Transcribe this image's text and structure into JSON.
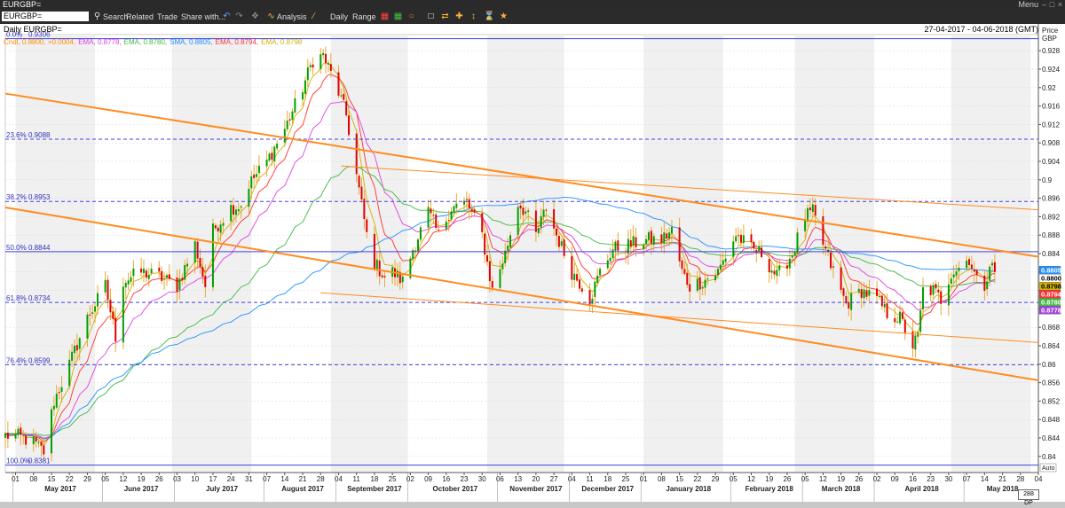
{
  "window": {
    "title": "EURGBP=",
    "menu": "Menu"
  },
  "toolbar": {
    "symbol": "EURGBP=",
    "search": "Search",
    "related": "Related",
    "trade": "Trade",
    "share": "Share with...",
    "analysis": "Analysis",
    "daily": "Daily",
    "range": "Range"
  },
  "header": {
    "label": "Daily EURGBP=",
    "date_range": "27-04-2017 - 04-06-2018 (GMT)",
    "price_label": "Price",
    "currency": "GBP"
  },
  "legend": [
    {
      "text": "Cndl, 0.8800, +0.0004,",
      "color": "#ff8c00"
    },
    {
      "text": "EMA, 0.8778,",
      "color": "#e040e0"
    },
    {
      "text": "EMA, 0.8780,",
      "color": "#40b840"
    },
    {
      "text": "SMA, 0.8805,",
      "color": "#2090ff"
    },
    {
      "text": "EMA, 0.8794,",
      "color": "#ff3030"
    },
    {
      "text": "EMA, 0.8798",
      "color": "#d0b000"
    }
  ],
  "status": {
    "zoom": "288 DP",
    "auto": "Auto"
  },
  "chart_data": {
    "type": "candlestick",
    "ylim": [
      0.8365,
      0.9315
    ],
    "yticks": [
      "0.84",
      "0.844",
      "0.848",
      "0.852",
      "0.856",
      "0.86",
      "0.864",
      "0.868",
      "0.872",
      "0.876",
      "0.88",
      "0.884",
      "0.888",
      "0.892",
      "0.896",
      "0.9",
      "0.904",
      "0.908",
      "0.912",
      "0.916",
      "0.92",
      "0.924",
      "0.928"
    ],
    "xticks": [
      "01",
      "08",
      "15",
      "22",
      "29",
      "05",
      "12",
      "19",
      "26",
      "03",
      "10",
      "17",
      "24",
      "31",
      "07",
      "14",
      "21",
      "28",
      "04",
      "11",
      "18",
      "25",
      "02",
      "09",
      "16",
      "23",
      "30",
      "06",
      "13",
      "20",
      "27",
      "04",
      "11",
      "18",
      "25",
      "01",
      "08",
      "15",
      "22",
      "29",
      "05",
      "12",
      "19",
      "26",
      "05",
      "12",
      "19",
      "26",
      "02",
      "09",
      "16",
      "23",
      "30",
      "07",
      "14",
      "21",
      "28",
      "04"
    ],
    "months": [
      "May 2017",
      "June 2017",
      "July 2017",
      "August 2017",
      "September 2017",
      "October 2017",
      "November 2017",
      "December 2017",
      "January 2018",
      "February 2018",
      "March 2018",
      "April 2018",
      "May 2018"
    ],
    "month_tick_index": [
      0,
      5,
      9,
      14,
      18,
      22,
      27,
      31,
      35,
      40,
      44,
      48,
      53
    ],
    "fib_levels": [
      {
        "label": "0.0%",
        "value": 0.9306,
        "text": "0.9306",
        "style": "solid"
      },
      {
        "label": "23.6%",
        "value": 0.9088,
        "text": "0.9088",
        "style": "dashed"
      },
      {
        "label": "38.2%",
        "value": 0.8953,
        "text": "0.8953",
        "style": "dashed"
      },
      {
        "label": "50.0%",
        "value": 0.8844,
        "text": "0.8844",
        "style": "solid"
      },
      {
        "label": "61.8%",
        "value": 0.8734,
        "text": "0.8734",
        "style": "dashed"
      },
      {
        "label": "76.4%",
        "value": 0.8599,
        "text": "0.8599",
        "style": "dashed"
      },
      {
        "label": "100.0%",
        "value": 0.8381,
        "text": "0.8381",
        "style": "solid"
      }
    ],
    "trendlines": [
      {
        "x1": "2017-04-27",
        "y1": 0.9187,
        "x2": "2018-06-04",
        "y2": 0.8833,
        "width": 2
      },
      {
        "x1": "2017-04-27",
        "y1": 0.894,
        "x2": "2018-06-04",
        "y2": 0.8565,
        "width": 2
      },
      {
        "x1": "2017-09-05",
        "y1": 0.903,
        "x2": "2018-06-04",
        "y2": 0.8935,
        "width": 1
      },
      {
        "x1": "2017-08-28",
        "y1": 0.8755,
        "x2": "2018-06-04",
        "y2": 0.8647,
        "width": 1
      }
    ],
    "price_badges": [
      {
        "text": "0.8805",
        "value": 0.8805,
        "bg": "#2090ff",
        "fg": "#ffffff"
      },
      {
        "text": "0.8800",
        "value": 0.88,
        "bg": "#ffffff",
        "fg": "#000000"
      },
      {
        "text": "0.8798",
        "value": 0.8798,
        "bg": "#d0b000",
        "fg": "#000000"
      },
      {
        "text": "0.8794",
        "value": 0.8794,
        "bg": "#ff3030",
        "fg": "#ffffff"
      },
      {
        "text": "0.8780",
        "value": 0.878,
        "bg": "#40b840",
        "fg": "#ffffff"
      },
      {
        "text": "0.8778",
        "value": 0.8778,
        "bg": "#a040e0",
        "fg": "#ffffff"
      }
    ],
    "price_anchors": [
      [
        "2017-05-01",
        0.8445
      ],
      [
        "2017-05-08",
        0.843
      ],
      [
        "2017-05-12",
        0.841
      ],
      [
        "2017-05-16",
        0.852
      ],
      [
        "2017-05-22",
        0.86
      ],
      [
        "2017-05-29",
        0.87
      ],
      [
        "2017-06-05",
        0.877
      ],
      [
        "2017-06-09",
        0.866
      ],
      [
        "2017-06-12",
        0.878
      ],
      [
        "2017-06-19",
        0.88
      ],
      [
        "2017-06-26",
        0.879
      ],
      [
        "2017-07-03",
        0.877
      ],
      [
        "2017-07-10",
        0.886
      ],
      [
        "2017-07-14",
        0.877
      ],
      [
        "2017-07-17",
        0.889
      ],
      [
        "2017-07-24",
        0.894
      ],
      [
        "2017-07-28",
        0.8945
      ],
      [
        "2017-07-31",
        0.899
      ],
      [
        "2017-08-07",
        0.904
      ],
      [
        "2017-08-14",
        0.911
      ],
      [
        "2017-08-21",
        0.92
      ],
      [
        "2017-08-25",
        0.926
      ],
      [
        "2017-08-29",
        0.927
      ],
      [
        "2017-09-04",
        0.919
      ],
      [
        "2017-09-07",
        0.914
      ],
      [
        "2017-09-11",
        0.901
      ],
      [
        "2017-09-15",
        0.888
      ],
      [
        "2017-09-18",
        0.882
      ],
      [
        "2017-09-22",
        0.879
      ],
      [
        "2017-09-25",
        0.88
      ],
      [
        "2017-09-29",
        0.878
      ],
      [
        "2017-10-03",
        0.885
      ],
      [
        "2017-10-09",
        0.893
      ],
      [
        "2017-10-13",
        0.888
      ],
      [
        "2017-10-18",
        0.894
      ],
      [
        "2017-10-24",
        0.895
      ],
      [
        "2017-10-30",
        0.888
      ],
      [
        "2017-11-03",
        0.876
      ],
      [
        "2017-11-08",
        0.884
      ],
      [
        "2017-11-13",
        0.895
      ],
      [
        "2017-11-16",
        0.893
      ],
      [
        "2017-11-20",
        0.888
      ],
      [
        "2017-11-24",
        0.894
      ],
      [
        "2017-11-28",
        0.888
      ],
      [
        "2017-12-04",
        0.88
      ],
      [
        "2017-12-08",
        0.877
      ],
      [
        "2017-12-11",
        0.874
      ],
      [
        "2017-12-15",
        0.88
      ],
      [
        "2017-12-20",
        0.885
      ],
      [
        "2017-12-27",
        0.886
      ],
      [
        "2018-01-03",
        0.887
      ],
      [
        "2018-01-08",
        0.887
      ],
      [
        "2018-01-12",
        0.889
      ],
      [
        "2018-01-16",
        0.88
      ],
      [
        "2018-01-19",
        0.877
      ],
      [
        "2018-01-24",
        0.878
      ],
      [
        "2018-01-30",
        0.88
      ],
      [
        "2018-02-06",
        0.888
      ],
      [
        "2018-02-12",
        0.885
      ],
      [
        "2018-02-16",
        0.884
      ],
      [
        "2018-02-22",
        0.879
      ],
      [
        "2018-02-28",
        0.884
      ],
      [
        "2018-03-05",
        0.892
      ],
      [
        "2018-03-08",
        0.893
      ],
      [
        "2018-03-12",
        0.886
      ],
      [
        "2018-03-16",
        0.88
      ],
      [
        "2018-03-21",
        0.873
      ],
      [
        "2018-03-27",
        0.876
      ],
      [
        "2018-04-02",
        0.874
      ],
      [
        "2018-04-06",
        0.871
      ],
      [
        "2018-04-11",
        0.87
      ],
      [
        "2018-04-16",
        0.864
      ],
      [
        "2018-04-18",
        0.866
      ],
      [
        "2018-04-20",
        0.876
      ],
      [
        "2018-04-24",
        0.876
      ],
      [
        "2018-04-27",
        0.874
      ],
      [
        "2018-05-01",
        0.88
      ],
      [
        "2018-05-04",
        0.881
      ],
      [
        "2018-05-08",
        0.883
      ],
      [
        "2018-05-11",
        0.878
      ],
      [
        "2018-05-14",
        0.877
      ],
      [
        "2018-05-16",
        0.882
      ],
      [
        "2018-05-18",
        0.88
      ]
    ]
  }
}
